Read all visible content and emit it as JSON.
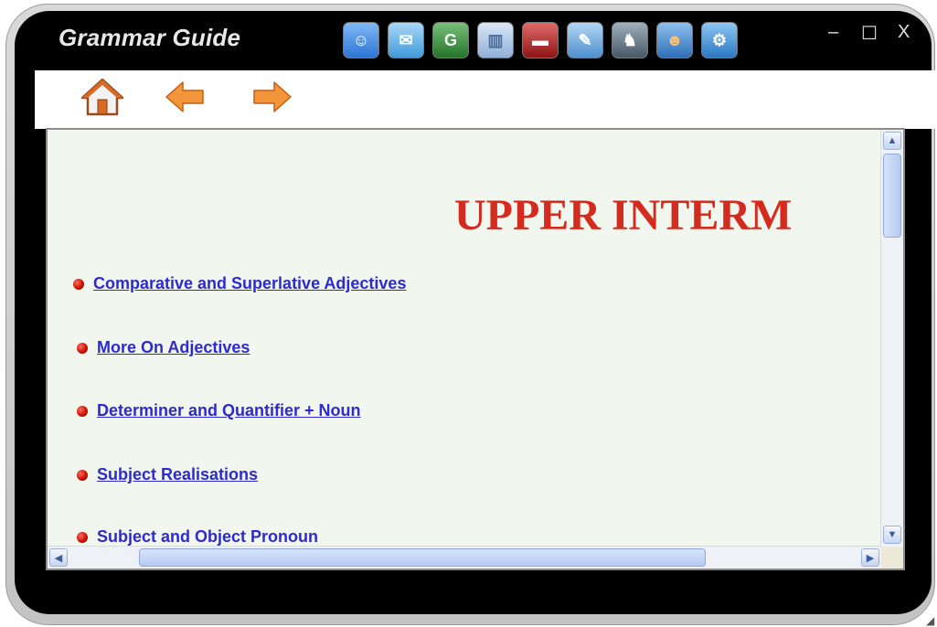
{
  "app": {
    "title": "Grammar Guide",
    "window_controls": {
      "minimize": "–",
      "maximize": "☐",
      "close": "X"
    }
  },
  "toolbar": {
    "icons": [
      {
        "name": "chat-icon",
        "color": "#3f8ee8",
        "glyph": "☺"
      },
      {
        "name": "mail-icon",
        "color": "#5db2e6",
        "glyph": "✉"
      },
      {
        "name": "grammar-student-icon",
        "color": "#3c8c3c",
        "glyph": "G"
      },
      {
        "name": "book-open-icon",
        "color": "#9ab8dd",
        "glyph": "▥"
      },
      {
        "name": "dictionary-icon",
        "color": "#b52222",
        "glyph": "▬"
      },
      {
        "name": "abc-icon",
        "color": "#6aa6d8",
        "glyph": "✎"
      },
      {
        "name": "puzzle-icon",
        "color": "#6b7d8c",
        "glyph": "♞"
      },
      {
        "name": "teacher-icon",
        "color": "#4a88cc",
        "glyph": "☻"
      },
      {
        "name": "settings-icon",
        "color": "#3b8fd6",
        "glyph": "⚙"
      }
    ]
  },
  "nav": {
    "home": "home-icon",
    "back": "back-arrow-icon",
    "forward": "forward-arrow-icon"
  },
  "content": {
    "heading": "UPPER INTERM",
    "topics": [
      "Comparative and Superlative Adjectives",
      "More On Adjectives",
      "Determiner and Quantifier + Noun",
      "Subject Realisations",
      "Subject and Object Pronoun"
    ]
  },
  "colors": {
    "heading": "#d42b1e",
    "link": "#2c2ad0",
    "content_bg": "#f1f6ee"
  }
}
